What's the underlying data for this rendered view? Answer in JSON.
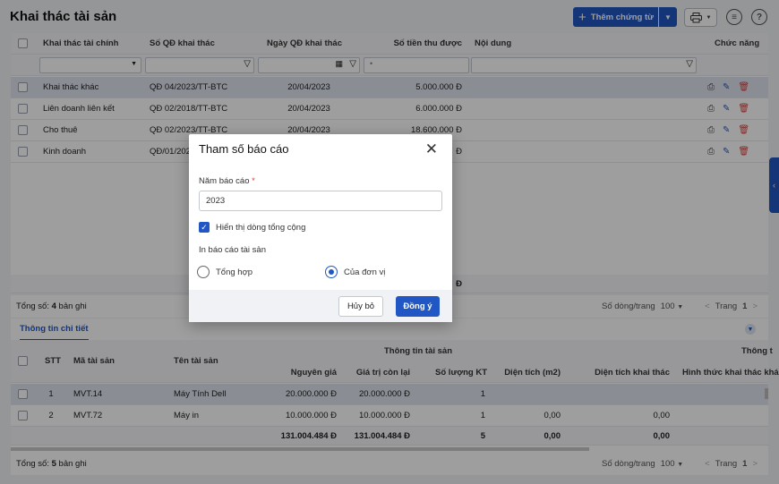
{
  "page": {
    "title": "Khai thác tài sản",
    "add_button": "Thêm chứng từ"
  },
  "main_grid": {
    "headers": {
      "col1": "Khai thác tài chính",
      "col2": "Số QĐ khai thác",
      "col3": "Ngày QĐ khai thác",
      "col4": "Số tiền thu được",
      "col5": "Nội dung",
      "col6": "Chức năng"
    },
    "rows": [
      {
        "type": "Khai thác khác",
        "decision": "QĐ 04/2023/TT-BTC",
        "date": "20/04/2023",
        "amount": "5.000.000 Đ"
      },
      {
        "type": "Liên doanh liên kết",
        "decision": "QĐ 02/2018/TT-BTC",
        "date": "20/04/2023",
        "amount": "6.000.000 Đ"
      },
      {
        "type": "Cho thuê",
        "decision": "QĐ 02/2023/TT-BTC",
        "date": "20/04/2023",
        "amount": "18.600.000 Đ"
      },
      {
        "type": "Kinh doanh",
        "decision": "QĐ/01/2022/TT-BTC",
        "date": "",
        "amount": "Đ"
      }
    ],
    "total_amount": "Đ"
  },
  "footer_top": {
    "total_prefix": "Tổng số: ",
    "total_count": "4",
    "total_suffix": " bản ghi",
    "rows_per_page_label": "Số dòng/trang",
    "rows_per_page": "100",
    "page_label": "Trang",
    "page": "1"
  },
  "detail": {
    "tab": "Thông tin chi tiết",
    "headers": {
      "stt": "STT",
      "code": "Mã tài sản",
      "name": "Tên tài sản",
      "group": "Thông tin tài sản",
      "group2": "Thông t",
      "original": "Nguyên giá",
      "remaining": "Giá trị còn lại",
      "qty": "Số lượng KT",
      "area": "Diện tích (m2)",
      "exploit_area": "Diện tích khai thác",
      "method": "Hình thức khai thác khá"
    },
    "rows": [
      {
        "stt": "1",
        "code": "MVT.14",
        "name": "Máy Tính Dell",
        "original": "20.000.000 Đ",
        "remaining": "20.000.000 Đ",
        "qty": "1",
        "area": "",
        "exploit_area": ""
      },
      {
        "stt": "2",
        "code": "MVT.72",
        "name": "Máy in",
        "original": "10.000.000 Đ",
        "remaining": "10.000.000 Đ",
        "qty": "1",
        "area": "0,00",
        "exploit_area": "0,00"
      }
    ],
    "totals": {
      "original": "131.004.484 Đ",
      "remaining": "131.004.484 Đ",
      "qty": "5",
      "area": "0,00",
      "exploit_area": "0,00"
    }
  },
  "footer_bottom": {
    "total_prefix": "Tổng số: ",
    "total_count": "5",
    "total_suffix": " bản ghi",
    "rows_per_page_label": "Số dòng/trang",
    "rows_per_page": "100",
    "page_label": "Trang",
    "page": "1"
  },
  "modal": {
    "title": "Tham số báo cáo",
    "year_label": "Năm báo cáo",
    "required_mark": "*",
    "year_value": "2023",
    "checkbox_label": "Hiển thị dòng tổng cộng",
    "section_label": "In báo cáo tài sản",
    "radio1": "Tổng hợp",
    "radio2": "Của đơn vị",
    "cancel": "Hủy bỏ",
    "ok": "Đồng ý"
  }
}
